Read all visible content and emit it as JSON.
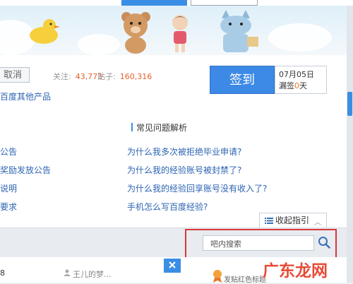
{
  "header": {
    "cancel_label": "取消",
    "stats": {
      "followers_label": "关注:",
      "followers_value": "43,773",
      "posts_label": "贴子:",
      "posts_value": "160,316"
    },
    "other_products_label": "百度其他产品",
    "sign_button_label": "签到",
    "date": "07月05日",
    "missed_prefix": "漏签",
    "missed_days": "0",
    "missed_suffix": "天"
  },
  "left_list": [
    "公告",
    "奖励发放公告",
    "说明",
    "要求"
  ],
  "faq": {
    "title": "常见问题解析",
    "items": [
      "为什么我多次被拒绝毕业申请?",
      "为什么我的经验账号被封禁了?",
      "为什么我的经验回享账号没有收入了?",
      "手机怎么写百度经验?"
    ]
  },
  "collapse_label": "收起指引",
  "search": {
    "placeholder": "吧内搜索"
  },
  "bottom": {
    "post_number": "8",
    "username": "王儿的梦..."
  },
  "watermark": {
    "text": "广东龙网",
    "sub": "发贴红色标题"
  },
  "colors": {
    "accent_blue": "#3a8ee6",
    "stat_orange": "#e3632d",
    "highlight_red": "#d9383a"
  }
}
